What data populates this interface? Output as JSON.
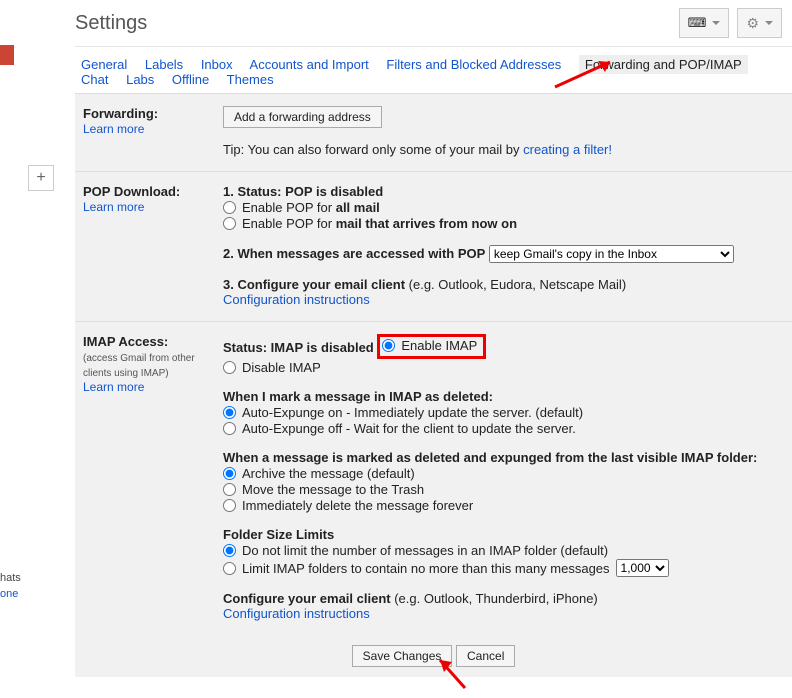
{
  "header": {
    "title": "Settings"
  },
  "tabs": {
    "general": "General",
    "labels": "Labels",
    "inbox": "Inbox",
    "accounts": "Accounts and Import",
    "filters": "Filters and Blocked Addresses",
    "forwarding": "Forwarding and POP/IMAP",
    "chat": "Chat",
    "labs": "Labs",
    "offline": "Offline",
    "themes": "Themes"
  },
  "fwd": {
    "label": "Forwarding:",
    "learn": "Learn more",
    "btn": "Add a forwarding address",
    "tip_pre": "Tip: You can also forward only some of your mail by ",
    "tip_link": "creating a filter!"
  },
  "pop": {
    "label": "POP Download:",
    "learn": "Learn more",
    "s1": "1. Status: POP is disabled",
    "o1_pre": "Enable POP for ",
    "o1_bold": "all mail",
    "o2_pre": "Enable POP for ",
    "o2_bold": "mail that arrives from now on",
    "s2": "2. When messages are accessed with POP",
    "select": "keep Gmail's copy in the Inbox",
    "s3_bold": "3. Configure your email client",
    "s3_rest": " (e.g. Outlook, Eudora, Netscape Mail)",
    "cfg": "Configuration instructions"
  },
  "imap": {
    "label": "IMAP Access:",
    "hint": "(access Gmail from other clients using IMAP)",
    "learn": "Learn more",
    "status": "Status: IMAP is disabled",
    "enable": "Enable IMAP",
    "disable": "Disable IMAP",
    "del_hdr": "When I mark a message in IMAP as deleted:",
    "del1": "Auto-Expunge on - Immediately update the server. (default)",
    "del2": "Auto-Expunge off - Wait for the client to update the server.",
    "exp_hdr": "When a message is marked as deleted and expunged from the last visible IMAP folder:",
    "exp1": "Archive the message (default)",
    "exp2": "Move the message to the Trash",
    "exp3": "Immediately delete the message forever",
    "fsl_hdr": "Folder Size Limits",
    "fsl1": "Do not limit the number of messages in an IMAP folder (default)",
    "fsl2": "Limit IMAP folders to contain no more than this many messages",
    "fsl_select": "1,000",
    "cfg_bold": "Configure your email client",
    "cfg_rest": " (e.g. Outlook, Thunderbird, iPhone)",
    "cfg_link": "Configuration instructions"
  },
  "footer": {
    "save": "Save Changes",
    "cancel": "Cancel"
  },
  "chat": {
    "l1": "hats",
    "l2": "one"
  },
  "icons": {
    "keyboard": "⌨",
    "gear": "⚙",
    "plus": "+"
  }
}
